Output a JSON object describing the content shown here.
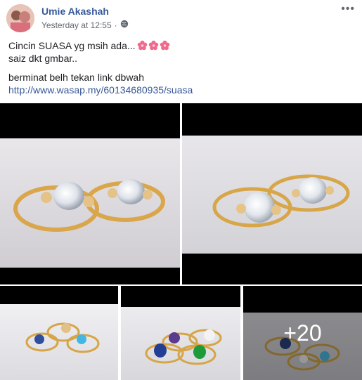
{
  "post": {
    "author": "Umie Akashah",
    "timestamp": "Yesterday at 12:55",
    "separator": "·",
    "privacy_icon": "globe-icon",
    "more_icon": "more-options-icon",
    "more_label": "•••",
    "lines": [
      "Cincin SUASA yg msih ada...",
      "saiz dkt gmbar..",
      "berminat belh tekan link dbwah"
    ],
    "link": "http://www.wasap.my/60134680935/suasa",
    "emoji_icon": "cherry-blossom-icon"
  },
  "gallery": {
    "more_count": "+20"
  },
  "colors": {
    "author": "#365899",
    "link": "#385898",
    "meta": "#606770"
  }
}
